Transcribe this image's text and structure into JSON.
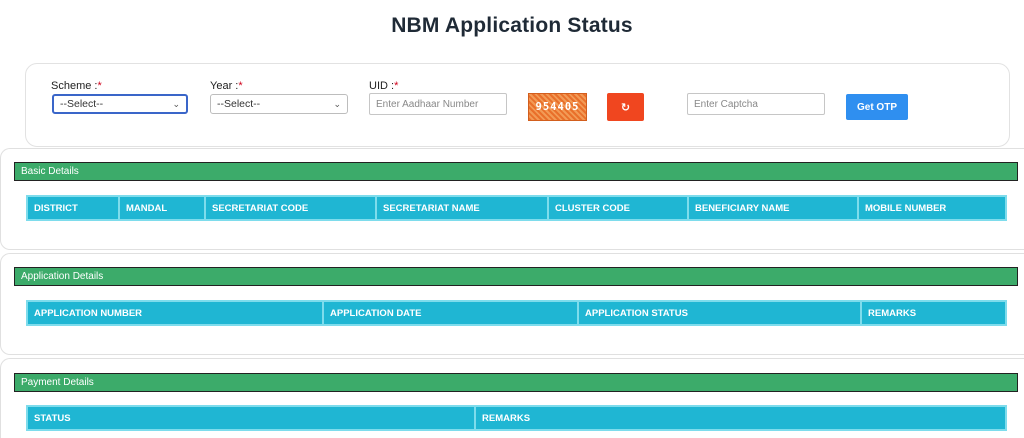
{
  "page": {
    "title": "NBM Application Status"
  },
  "form": {
    "scheme": {
      "label": "Scheme :",
      "required_mark": "*",
      "value": "--Select--"
    },
    "year": {
      "label": "Year :",
      "required_mark": "*",
      "value": "--Select--"
    },
    "uid": {
      "label": "UID :",
      "required_mark": "*",
      "placeholder": "Enter Aadhaar Number"
    },
    "captcha": {
      "code": "954405",
      "refresh_icon": "refresh-icon",
      "placeholder": "Enter Captcha"
    },
    "get_otp_label": "Get OTP"
  },
  "sections": {
    "basic": {
      "title": "Basic Details",
      "columns": [
        "DISTRICT",
        "MANDAL",
        "SECRETARIAT CODE",
        "SECRETARIAT NAME",
        "CLUSTER CODE",
        "BENEFICIARY NAME",
        "MOBILE NUMBER"
      ]
    },
    "application": {
      "title": "Application Details",
      "columns": [
        "APPLICATION NUMBER",
        "APPLICATION DATE",
        "APPLICATION STATUS",
        "REMARKS"
      ]
    },
    "payment": {
      "title": "Payment Details",
      "columns": [
        "STATUS",
        "REMARKS"
      ]
    }
  },
  "colors": {
    "section_header": "#3cab6a",
    "table_header": "#1fb6d3",
    "primary_button": "#2f8ff0",
    "refresh_button": "#f0461f"
  }
}
